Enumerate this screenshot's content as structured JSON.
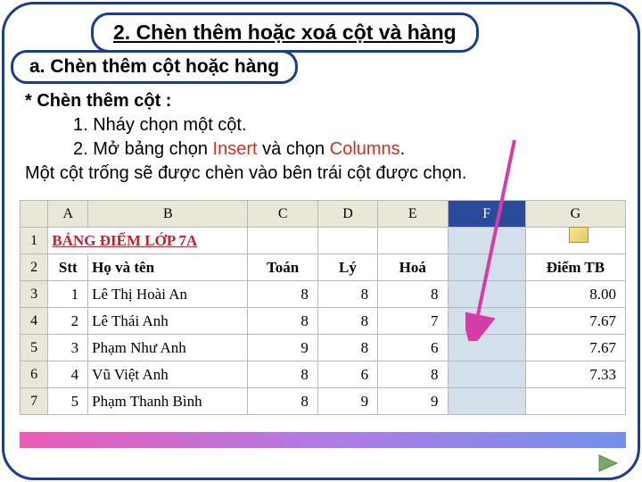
{
  "title": "2. Chèn thêm hoặc xoá cột và hàng",
  "subtitle": "a. Chèn thêm cột hoặc hàng",
  "instructions": {
    "heading": "* Chèn thêm cột :",
    "step1": "1. Nháy chọn một cột.",
    "step2_pre": "2. Mở bảng chọn ",
    "step2_red1": "Insert",
    "step2_mid": " và chọn ",
    "step2_red2": "Columns",
    "step2_post": ".",
    "result": "Một cột trống sẽ được chèn vào bên trái cột được chọn."
  },
  "columns": [
    "A",
    "B",
    "C",
    "D",
    "E",
    "F",
    "G"
  ],
  "row_numbers": [
    "1",
    "2",
    "3",
    "4",
    "5",
    "6",
    "7"
  ],
  "sheet": {
    "r1_title": "BẢNG ĐIỂM LỚP 7A",
    "r2": {
      "stt": "Stt",
      "name": "Họ và tên",
      "toan": "Toán",
      "ly": "Lý",
      "hoa": "Hoá",
      "tb": "Điểm TB"
    },
    "rows": [
      {
        "stt": "1",
        "name": "Lê Thị Hoài An",
        "toan": "8",
        "ly": "8",
        "hoa": "8",
        "tb": "8.00"
      },
      {
        "stt": "2",
        "name": "Lê Thái Anh",
        "toan": "8",
        "ly": "8",
        "hoa": "7",
        "tb": "7.67"
      },
      {
        "stt": "3",
        "name": "Phạm Như Anh",
        "toan": "9",
        "ly": "8",
        "hoa": "6",
        "tb": "7.67"
      },
      {
        "stt": "4",
        "name": "Vũ Việt Anh",
        "toan": "8",
        "ly": "6",
        "hoa": "8",
        "tb": "7.33"
      },
      {
        "stt": "5",
        "name": "Phạm Thanh Bình",
        "toan": "8",
        "ly": "9",
        "hoa": "9",
        "tb": ""
      }
    ]
  }
}
